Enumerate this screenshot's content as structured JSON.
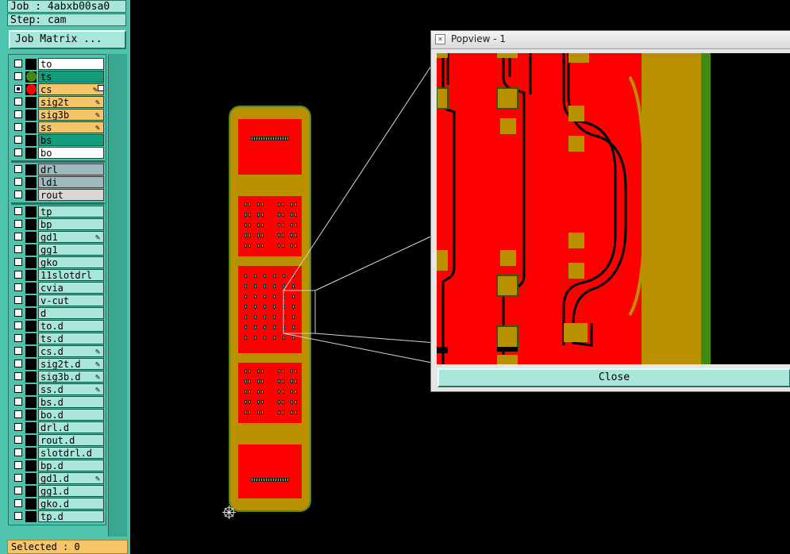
{
  "job_label": "Job : 4abxb00sa0",
  "step_label": "Step: cam",
  "job_matrix_button": "Job Matrix ...",
  "layer_groups": {
    "signal": [
      {
        "name": "to",
        "fill": "#ffffff",
        "indicator": "none",
        "checked": false,
        "mark": ""
      },
      {
        "name": "ts",
        "fill": "#129e7d",
        "indicator": "#3f8a12",
        "checked": false,
        "mark": ""
      },
      {
        "name": "cs",
        "fill": "#f6c56a",
        "indicator": "#ff0000",
        "checked": true,
        "mark": "pen+box"
      },
      {
        "name": "sig2t",
        "fill": "#f6c56a",
        "indicator": "none",
        "checked": false,
        "mark": "pen"
      },
      {
        "name": "sig3b",
        "fill": "#f6c56a",
        "indicator": "none",
        "checked": false,
        "mark": "pen"
      },
      {
        "name": "ss",
        "fill": "#f6c56a",
        "indicator": "none",
        "checked": false,
        "mark": "pen"
      },
      {
        "name": "bs",
        "fill": "#129e7d",
        "indicator": "none",
        "checked": false,
        "mark": ""
      },
      {
        "name": "bo",
        "fill": "#ffffff",
        "indicator": "none",
        "checked": false,
        "mark": ""
      }
    ],
    "drill": [
      {
        "name": "drl",
        "fill": "#9fb9be",
        "mark": ""
      },
      {
        "name": "ldi",
        "fill": "#9fb9be",
        "mark": ""
      },
      {
        "name": "rout",
        "fill": "#d8d8d8",
        "mark": ""
      }
    ],
    "misc": [
      {
        "name": "tp",
        "mark": ""
      },
      {
        "name": "bp",
        "mark": ""
      },
      {
        "name": "gd1",
        "mark": "pen"
      },
      {
        "name": "gg1",
        "mark": ""
      },
      {
        "name": "gko",
        "mark": ""
      },
      {
        "name": "11slotdrl",
        "mark": ""
      },
      {
        "name": "cvia",
        "mark": ""
      },
      {
        "name": "v-cut",
        "mark": ""
      },
      {
        "name": "d",
        "mark": ""
      },
      {
        "name": "to.d",
        "mark": ""
      },
      {
        "name": "ts.d",
        "mark": ""
      },
      {
        "name": "cs.d",
        "mark": "pen"
      },
      {
        "name": "sig2t.d",
        "mark": "pen"
      },
      {
        "name": "sig3b.d",
        "mark": "pen"
      },
      {
        "name": "ss.d",
        "mark": "pen"
      },
      {
        "name": "bs.d",
        "mark": ""
      },
      {
        "name": "bo.d",
        "mark": ""
      },
      {
        "name": "drl.d",
        "mark": ""
      },
      {
        "name": "rout.d",
        "mark": ""
      },
      {
        "name": "slotdrl.d",
        "mark": ""
      },
      {
        "name": "bp.d",
        "mark": ""
      },
      {
        "name": "gd1.d",
        "mark": "pen"
      },
      {
        "name": "gg1.d",
        "mark": ""
      },
      {
        "name": "gko.d",
        "mark": ""
      },
      {
        "name": "tp.d",
        "mark": ""
      }
    ],
    "misc_fill": "#a8e6da"
  },
  "status_text": "Selected : 0",
  "popview": {
    "title": "Popview - 1",
    "close_label": "Close"
  },
  "colors": {
    "panel_bg": "#4fc4ac",
    "board_substrate": "#b99100",
    "board_copper": "#ff0000",
    "board_outline": "#4c8a1e",
    "background": "#000000"
  }
}
